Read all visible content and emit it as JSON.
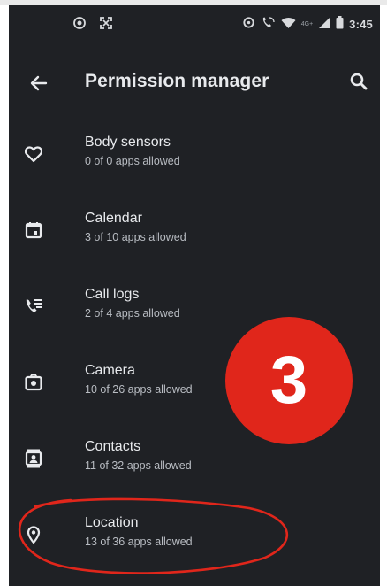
{
  "status_bar": {
    "time": "3:45",
    "left_icons": [
      "camera-notification-icon",
      "screenshot-notification-icon"
    ],
    "right_icons": [
      "data-saver-icon",
      "wifi-call-icon",
      "wifi-icon",
      "signal-icon",
      "battery-icon"
    ],
    "network_label": "4G+"
  },
  "toolbar": {
    "title": "Permission manager",
    "back_icon": "back-arrow-icon",
    "search_icon": "search-icon"
  },
  "permissions": [
    {
      "label": "Body sensors",
      "summary": "0 of 0 apps allowed",
      "icon": "heart-icon"
    },
    {
      "label": "Calendar",
      "summary": "3 of 10 apps allowed",
      "icon": "calendar-icon"
    },
    {
      "label": "Call logs",
      "summary": "2 of 4 apps allowed",
      "icon": "call-log-icon"
    },
    {
      "label": "Camera",
      "summary": "10 of 26 apps allowed",
      "icon": "camera-icon"
    },
    {
      "label": "Contacts",
      "summary": "11 of 32 apps allowed",
      "icon": "contacts-icon"
    },
    {
      "label": "Location",
      "summary": "13 of 36 apps allowed",
      "icon": "location-pin-icon"
    }
  ],
  "annotation": {
    "step_number": "3",
    "badge_color": "#e0261b",
    "highlight_color": "#e0261b",
    "highlighted_item": "Location"
  },
  "colors": {
    "background": "#1f2125",
    "text_primary": "#e8eaed",
    "text_secondary": "#b8bcc2"
  }
}
